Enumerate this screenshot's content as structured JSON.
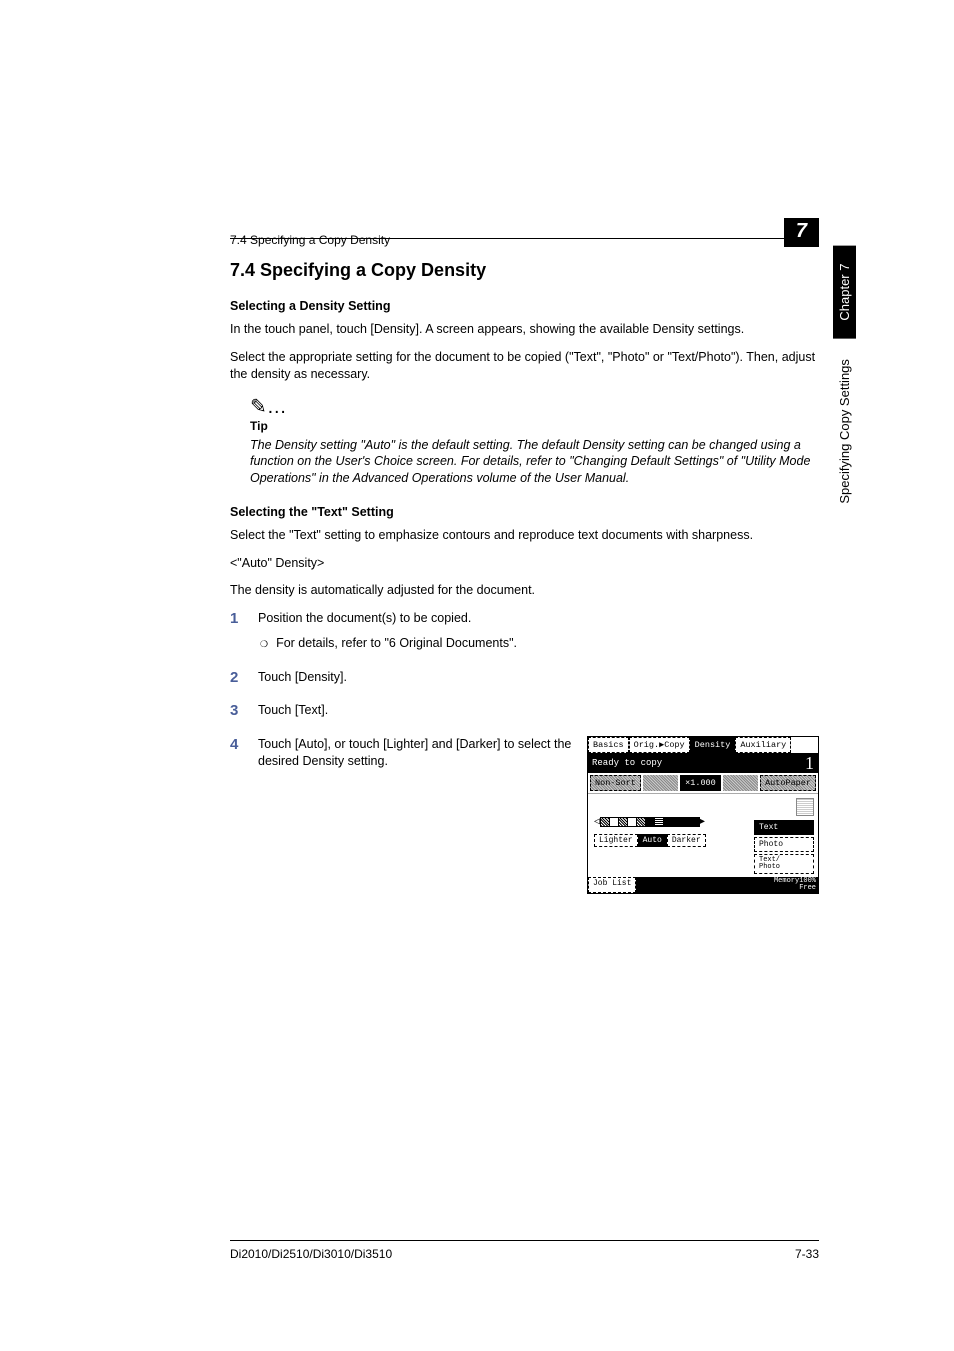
{
  "header": {
    "section_ref": "7.4 Specifying a Copy Density",
    "chapter_num": "7"
  },
  "sidetab": {
    "chapter": "Chapter 7",
    "title": "Specifying Copy Settings"
  },
  "heading": "7.4    Specifying a Copy Density",
  "sub1_title": "Selecting a Density Setting",
  "sub1_p1": "In the touch panel, touch [Density]. A screen appears, showing the available Density settings.",
  "sub1_p2": "Select the appropriate setting for the document to be copied (\"Text\", \"Photo\" or \"Text/Photo\"). Then, adjust the density as necessary.",
  "tip": {
    "icon": "✎…",
    "label": "Tip",
    "body": "The Density setting \"Auto\" is the default setting. The default Density setting can be changed using a function on the User's Choice screen. For details, refer to \"Changing Default Settings\" of \"Utility Mode Operations\" in the Advanced Operations volume of the User Manual."
  },
  "sub2_title": "Selecting the \"Text\" Setting",
  "sub2_p1": "Select the \"Text\" setting to emphasize contours and reproduce text documents with sharpness.",
  "sub2_p2": "<\"Auto\" Density>",
  "sub2_p3": "The density is automatically adjusted for the document.",
  "steps": {
    "s1": {
      "num": "1",
      "text": "Position the document(s) to be copied.",
      "sub": "For details, refer to \"6 Original Documents\"."
    },
    "s2": {
      "num": "2",
      "text": "Touch [Density]."
    },
    "s3": {
      "num": "3",
      "text": "Touch [Text]."
    },
    "s4": {
      "num": "4",
      "text": "Touch [Auto], or touch [Lighter] and [Darker] to select the desired Density setting."
    }
  },
  "screen": {
    "tabs": {
      "basics": "Basics",
      "origcopy": "Orig.▶Copy",
      "density": "Density",
      "auxiliary": "Auxiliary"
    },
    "status": "Ready to copy",
    "count": "1",
    "row2": {
      "nonsort": "Non-Sort",
      "zoom": "×1.000",
      "autopaper": "AutoPaper"
    },
    "buttons": {
      "lighter": "Lighter",
      "auto": "Auto",
      "darker": "Darker"
    },
    "modes": {
      "text": "Text",
      "photo": "Photo",
      "textphoto": "Text/\nPhoto"
    },
    "joblist": "Job List",
    "memory": "Memory100%\nFree"
  },
  "footer": {
    "left": "Di2010/Di2510/Di3010/Di3510",
    "right": "7-33"
  }
}
